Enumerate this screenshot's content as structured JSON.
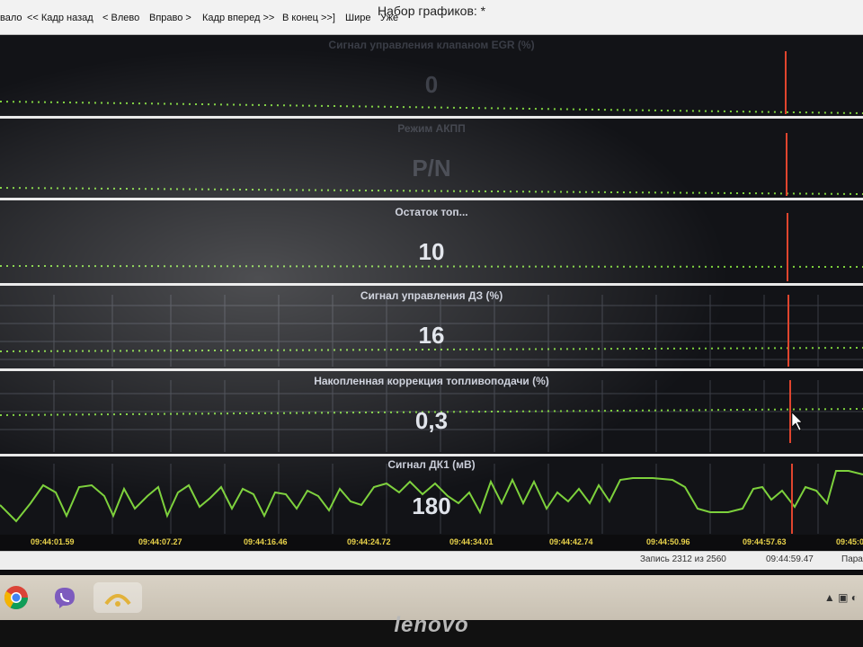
{
  "toolbar": {
    "title": "Набор графиков: *",
    "buttons": [
      "вало",
      "<< Кадр назад",
      "< Влево",
      "Вправо >",
      "Кадр вперед >>",
      "В конец >>]",
      "Шире",
      "Уже"
    ]
  },
  "charts": [
    {
      "title": "Сигнал управления клапаном EGR  (%)",
      "value": "0"
    },
    {
      "title": "Режим АКПП",
      "value": "P/N"
    },
    {
      "title": "Остаток топ...",
      "value": "10"
    },
    {
      "title": "Сигнал управления ДЗ  (%)",
      "value": "16"
    },
    {
      "title": "Накопленная коррекция топливоподачи  (%)",
      "value": "0,3"
    },
    {
      "title": "Сигнал ДК1  (мВ)",
      "value": "180"
    }
  ],
  "time_axis": [
    "09:44:01.59",
    "09:44:07.27",
    "09:44:16.46",
    "09:44:24.72",
    "09:44:34.01",
    "09:44:42.74",
    "09:44:50.96",
    "09:44:57.63",
    "09:45:0"
  ],
  "status": {
    "record": "Запись 2312 из 2560",
    "time": "09:44:59.47",
    "param": "Пара"
  },
  "taskbar": {
    "icons": [
      "chrome-icon",
      "viber-icon",
      "app-icon"
    ]
  },
  "bezel_brand": "lenovo",
  "colors": {
    "line": "#7dd13c",
    "cursor": "#e0452e",
    "axis_text": "#e8d24a"
  }
}
